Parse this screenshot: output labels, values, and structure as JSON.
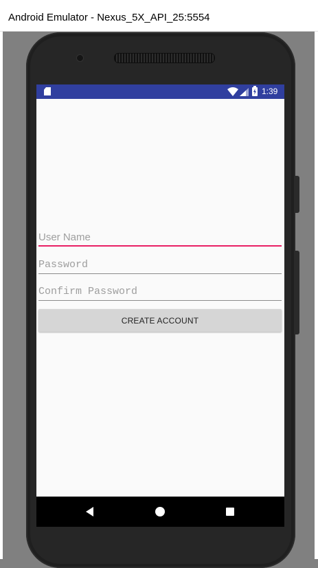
{
  "window": {
    "title": "Android Emulator - Nexus_5X_API_25:5554"
  },
  "status_bar": {
    "time": "1:39",
    "color": "#303f9f",
    "icons": [
      "sd-card-icon",
      "wifi-icon",
      "signal-icon",
      "battery-charging-icon"
    ]
  },
  "form": {
    "username_placeholder": "User Name",
    "password_placeholder": "Password",
    "confirm_placeholder": "Confirm Password",
    "username_value": "",
    "password_value": "",
    "confirm_value": "",
    "accent_color": "#e91e63",
    "create_button_label": "CREATE ACCOUNT"
  },
  "nav_bar": {
    "icons": [
      "back-icon",
      "home-icon",
      "recents-icon"
    ]
  }
}
